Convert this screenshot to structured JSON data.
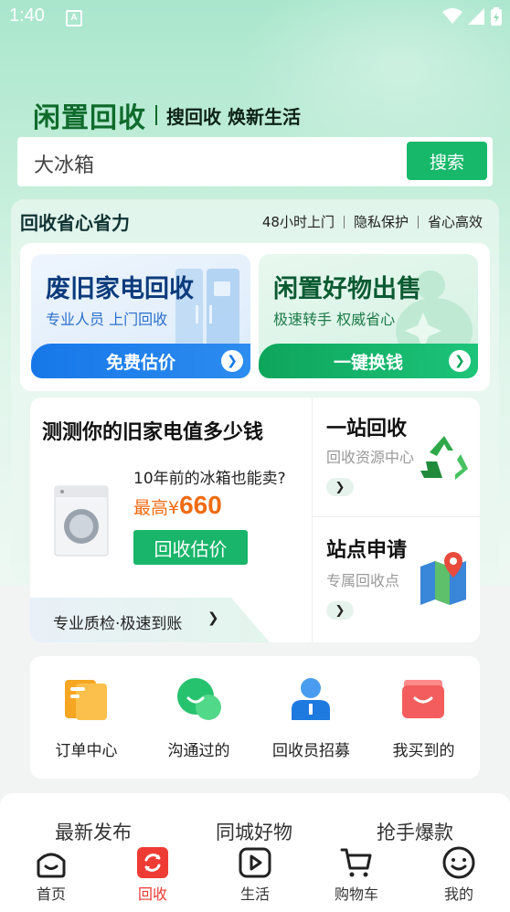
{
  "status_bar": {
    "time": "1:40",
    "notification_icon": "A"
  },
  "brand": {
    "logo_text": "闲置回收",
    "slogan": "搜回收 焕新生活"
  },
  "search": {
    "value": "大冰箱",
    "button_label": "搜索"
  },
  "section": {
    "title": "回收省心省力",
    "tags": [
      "48小时上门",
      "隐私保护",
      "省心高效"
    ]
  },
  "cards": [
    {
      "title": "废旧家电回收",
      "subtitle": "专业人员 上门回收",
      "action": "免费估价",
      "color": "#1677e8"
    },
    {
      "title": "闲置好物出售",
      "subtitle": "极速转手 权威省心",
      "action": "一键换钱",
      "color": "#0ea55b"
    }
  ],
  "appraisal": {
    "title": "测测你的旧家电值多少钱",
    "question": "10年前的冰箱也能卖?",
    "price_prefix": "最高¥",
    "price_value": "660",
    "button_label": "回收估价",
    "footer": "专业质检·极速到账",
    "footer_arrow": "❯"
  },
  "side_items": [
    {
      "title": "一站回收",
      "subtitle": "回收资源中心",
      "icon": "recycle-icon",
      "arrow": "❯"
    },
    {
      "title": "站点申请",
      "subtitle": "专属回收点",
      "icon": "map-pin-icon",
      "arrow": "❯"
    }
  ],
  "quick_actions": [
    {
      "label": "订单中心",
      "icon": "order-icon"
    },
    {
      "label": "沟通过的",
      "icon": "chat-icon"
    },
    {
      "label": "回收员招募",
      "icon": "recruit-icon"
    },
    {
      "label": "我买到的",
      "icon": "bag-icon"
    }
  ],
  "feed_tabs": [
    "最新发布",
    "同城好物",
    "抢手爆款"
  ],
  "tab_bar": [
    {
      "label": "首页",
      "icon": "home-icon",
      "active": false
    },
    {
      "label": "回收",
      "icon": "recycle-tab-icon",
      "active": true
    },
    {
      "label": "生活",
      "icon": "play-icon",
      "active": false
    },
    {
      "label": "购物车",
      "icon": "cart-icon",
      "active": false
    },
    {
      "label": "我的",
      "icon": "profile-icon",
      "active": false
    }
  ],
  "colors": {
    "brand_green": "#17b86a",
    "accent_orange": "#f06b12",
    "active_red": "#ee3b34"
  }
}
